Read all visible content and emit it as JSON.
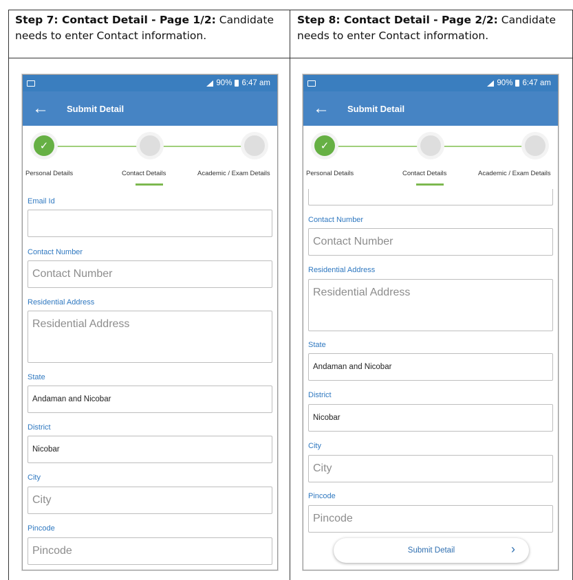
{
  "captions": {
    "left": {
      "step": "Step 7: Contact Detail - Page 1/2:",
      "text": " Candidate needs to enter Contact information."
    },
    "right": {
      "step": "Step 8: Contact Detail - Page 2/2:",
      "text": " Candidate needs to enter Contact information."
    }
  },
  "status_bar": {
    "battery": "90%",
    "time": "6:47 am"
  },
  "app_bar": {
    "title": "Submit Detail",
    "back_icon": "back-arrow-icon"
  },
  "stepper": {
    "steps": [
      {
        "label": "Personal Details",
        "state": "completed"
      },
      {
        "label": "Contact Details",
        "state": "current"
      },
      {
        "label": "Academic / Exam Details",
        "state": "pending"
      }
    ]
  },
  "form": {
    "email": {
      "label": "Email Id",
      "value": ""
    },
    "contact_number": {
      "label": "Contact Number",
      "placeholder": "Contact Number"
    },
    "address": {
      "label": "Residential Address",
      "placeholder": "Residential Address"
    },
    "state": {
      "label": "State",
      "value": "Andaman and Nicobar"
    },
    "district": {
      "label": "District",
      "value": "Nicobar"
    },
    "city": {
      "label": "City",
      "placeholder": "City"
    },
    "pincode": {
      "label": "Pincode",
      "placeholder": "Pincode"
    },
    "submit_label": "Submit Detail"
  },
  "colors": {
    "app_bar": "#4684c4",
    "status_bar": "#3a7ebf",
    "step_done": "#66b044",
    "label_blue": "#2f78c0"
  }
}
